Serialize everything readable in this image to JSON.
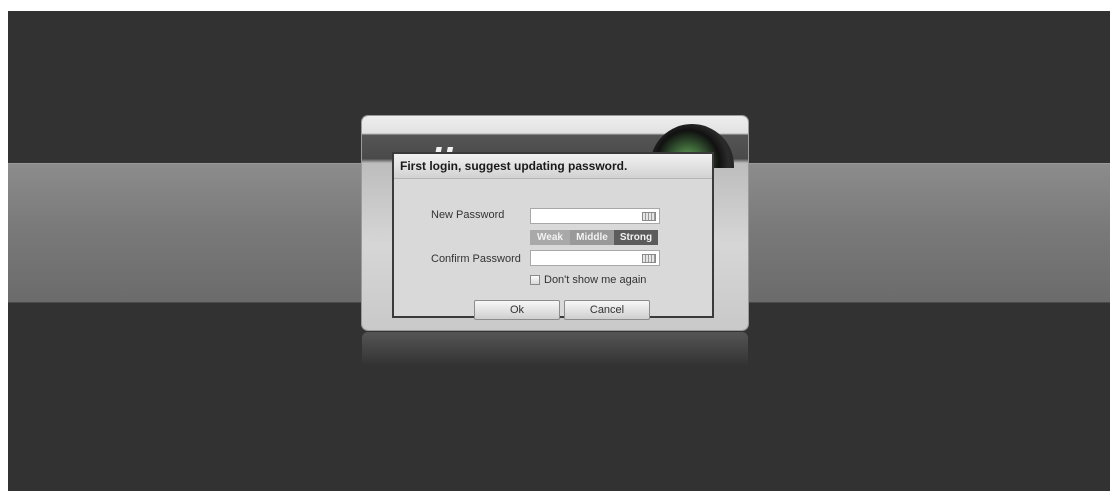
{
  "brand": {
    "logo_text": "alhua"
  },
  "dialog": {
    "title": "First login, suggest updating password.",
    "new_password": {
      "label": "New Password",
      "value": "",
      "placeholder": ""
    },
    "confirm_password": {
      "label": "Confirm Password",
      "value": "",
      "placeholder": ""
    },
    "strength": {
      "weak": "Weak",
      "middle": "Middle",
      "strong": "Strong"
    },
    "dont_show": {
      "label": "Don't show me again",
      "checked": false
    },
    "ok_label": "Ok",
    "cancel_label": "Cancel"
  },
  "icons": {
    "keyboard": "keyboard-icon",
    "checkbox": "checkbox"
  },
  "colors": {
    "background": "#323232",
    "band": "#7a7a7a",
    "dialog_bg": "#d9d9d9",
    "dialog_border": "#3a3a3a",
    "strength_strong": "#5c5c5c"
  }
}
